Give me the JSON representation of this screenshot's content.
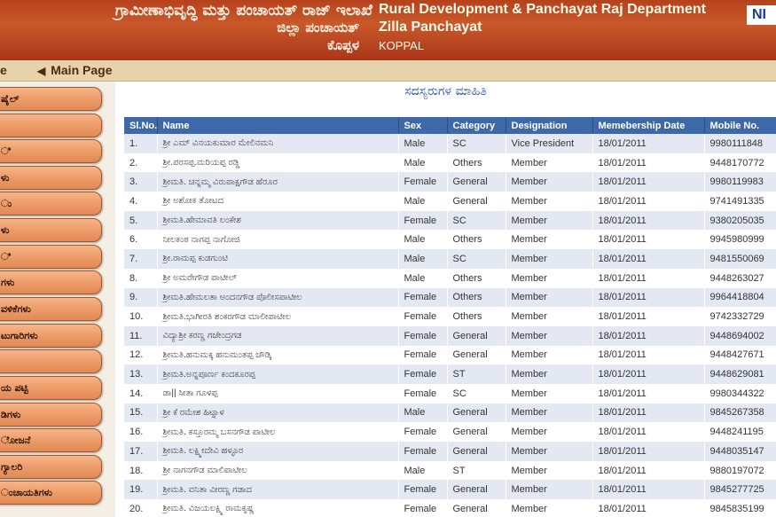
{
  "header": {
    "kn_line1": "ಗ್ರಾಮೀಣಾಭಿವೃದ್ಧಿ ಮತ್ತು ಪಂಚಾಯತ್ ರಾಜ್ ಇಲಾಖೆ",
    "kn_line2": "ಜಿಲ್ಲಾ ಪಂಚಾಯತ್",
    "kn_line3": "ಕೊಪ್ಪಳ",
    "en_line1": "Rural Development & Panchayat Raj Department",
    "en_line2": "Zilla Panchayat",
    "en_line3": "KOPPAL",
    "logo_text": "NI"
  },
  "navbar": {
    "home_label": "e",
    "main_page_label": "Main Page"
  },
  "sidebar": {
    "items": [
      {
        "label": "ಷೈಲ್"
      },
      {
        "label": ""
      },
      {
        "label": "ಿ"
      },
      {
        "label": "ಳು"
      },
      {
        "label": "ು"
      },
      {
        "label": "ಳು"
      },
      {
        "label": "ಿ"
      },
      {
        "label": "ಗಳು"
      },
      {
        "label": "ವಳಿಕೆಗಳು"
      },
      {
        "label": "ಟುಗಾರಿಗಳು"
      },
      {
        "label": ""
      },
      {
        "label": "ಯ ಪಟ್ಟಿ"
      },
      {
        "label": "ಡಿಗಳು"
      },
      {
        "label": "ೋಜನೆ"
      },
      {
        "label": "ಗ್ಯಾಲರಿ"
      },
      {
        "label": "ಂಚಾಯತಿಗಳು"
      }
    ]
  },
  "main": {
    "title": "ಸದಸ್ಯರುಗಳ ಮಾಹಿತಿ",
    "table": {
      "columns": [
        "Sl.No.",
        "Name",
        "Sex",
        "Category",
        "Designation",
        "Memebership Date",
        "Mobile No."
      ],
      "rows": [
        {
          "sl": "1.",
          "name": "ಶ್ರೀ ಎಮ್ ವಿನಯಕುಮಾರ ಮೇಲಿನಮನಿ",
          "sex": "Male",
          "category": "SC",
          "designation": "Vice President",
          "date": "18/01/2011",
          "mobile": "9980111848"
        },
        {
          "sl": "2.",
          "name": "ಶ್ರೀ.ಪರಸಪ್ಪ.ಮರಿಯಪ್ಪ ರಡ್ಡಿ",
          "sex": "Male",
          "category": "Others",
          "designation": "Member",
          "date": "18/01/2011",
          "mobile": "9448170772"
        },
        {
          "sl": "3.",
          "name": "ಶ್ರೀಮತಿ. ಚನ್ನಮ್ಮ ವಿರುಪಾಕ್ಷಗೌಡ ಹೆರೂರ",
          "sex": "Female",
          "category": "General",
          "designation": "Member",
          "date": "18/01/2011",
          "mobile": "9980119983"
        },
        {
          "sl": "4.",
          "name": "ಶ್ರೀ ಅಶೋಕ ತೋಟದ",
          "sex": "Male",
          "category": "General",
          "designation": "Member",
          "date": "18/01/2011",
          "mobile": "9741491335"
        },
        {
          "sl": "5.",
          "name": "ಶ್ರೀಮತಿ.ಹೇಮಾವತಿ ಲಂಕೇಶ",
          "sex": "Female",
          "category": "SC",
          "designation": "Member",
          "date": "18/01/2011",
          "mobile": "9380205035"
        },
        {
          "sl": "6.",
          "name": "ನೀಲಕಂಠ ನಾಗಪ್ಪ ನಾಗೋಜಿ",
          "sex": "Male",
          "category": "Others",
          "designation": "Member",
          "date": "18/01/2011",
          "mobile": "9945980999"
        },
        {
          "sl": "7.",
          "name": "ಶ್ರೀ.ರಾಮಪ್ಪ ಕುಡಗುಂಟಿ",
          "sex": "Male",
          "category": "SC",
          "designation": "Member",
          "date": "18/01/2011",
          "mobile": "9481550069"
        },
        {
          "sl": "8.",
          "name": "ಶ್ರೀ ಅಮರೇಗೌಡ ಪಾಟೀಲ್",
          "sex": "Male",
          "category": "Others",
          "designation": "Member",
          "date": "18/01/2011",
          "mobile": "9448263027"
        },
        {
          "sl": "9.",
          "name": "ಶ್ರೀಮತಿ.ಹೇಮಲತಾ ಅಂದನಗೌಡ ಪೊಲೀಸಪಾಟೀಲ",
          "sex": "Female",
          "category": "Others",
          "designation": "Member",
          "date": "18/01/2011",
          "mobile": "9964418804"
        },
        {
          "sl": "10.",
          "name": "ಶ್ರೀಮತಿ.ಭಾಗೀರತಿ ಶಂಕರಗೌಡ ಮಾಲೀಪಾಟೀಲ",
          "sex": "Female",
          "category": "Others",
          "designation": "Member",
          "date": "18/01/2011",
          "mobile": "9742332729"
        },
        {
          "sl": "11.",
          "name": "ವಿದ್ಯಾಶ್ರೀ ಕರಣ್ಣ ಗಜೇಂದ್ರಗಡ",
          "sex": "Female",
          "category": "General",
          "designation": "Member",
          "date": "18/01/2011",
          "mobile": "9448694002"
        },
        {
          "sl": "12.",
          "name": "ಶ್ರೀಮತಿ.ಹನುಮಕ್ಕ ಹನುಮಂತಪ್ಪ ಚೌಡ್ಕಿ",
          "sex": "Female",
          "category": "General",
          "designation": "Member",
          "date": "18/01/2011",
          "mobile": "9448427671"
        },
        {
          "sl": "13.",
          "name": "ಶ್ರೀಮತಿ.ಅನ್ನಪೂರ್ಣ ಕಂದಕೂರಪ್ಪ",
          "sex": "Female",
          "category": "ST",
          "designation": "Member",
          "date": "18/01/2011",
          "mobile": "9448629081"
        },
        {
          "sl": "14.",
          "name": "ಡಾ|| ಸೀತಾ ಗೂಳಪ್ಪ",
          "sex": "Female",
          "category": "SC",
          "designation": "Member",
          "date": "18/01/2011",
          "mobile": "9980344322"
        },
        {
          "sl": "15.",
          "name": "ಶ್ರೀ ಕೆ ರಮೇಶ ಹಿಟ್ನಾಳ",
          "sex": "Male",
          "category": "General",
          "designation": "Member",
          "date": "18/01/2011",
          "mobile": "9845267358"
        },
        {
          "sl": "16.",
          "name": "ಶ್ರೀಮತಿ. ಕಸ್ತೂರಮ್ಮ ಬಸನಗೌಡ ಪಾಟೀಲ",
          "sex": "Female",
          "category": "General",
          "designation": "Member",
          "date": "18/01/2011",
          "mobile": "9448241195"
        },
        {
          "sl": "17.",
          "name": "ಶ್ರೀಮತಿ. ಲಕ್ಷ್ಮೀದೇವಿ ಹಳ್ಳೂರ",
          "sex": "Female",
          "category": "General",
          "designation": "Member",
          "date": "18/01/2011",
          "mobile": "9448035147"
        },
        {
          "sl": "18.",
          "name": "ಶ್ರೀ ನಾಗನಗೌಡ ಮಾಲಿಪಾಟೀಲ",
          "sex": "Male",
          "category": "ST",
          "designation": "Member",
          "date": "18/01/2011",
          "mobile": "9880197072"
        },
        {
          "sl": "19.",
          "name": "ಶ್ರೀಮತಿ. ವನಿತಾ ವೀರಣ್ಣ ಗಡಾದ",
          "sex": "Female",
          "category": "General",
          "designation": "Member",
          "date": "18/01/2011",
          "mobile": "9845277725"
        },
        {
          "sl": "20.",
          "name": "ಶ್ರೀಮತಿ. ವಿಜಯಲಕ್ಷ್ಮಿ ರಾಮಕೃಷ್ಣ",
          "sex": "Female",
          "category": "General",
          "designation": "Member",
          "date": "18/01/2011",
          "mobile": "9845835199"
        }
      ]
    }
  }
}
